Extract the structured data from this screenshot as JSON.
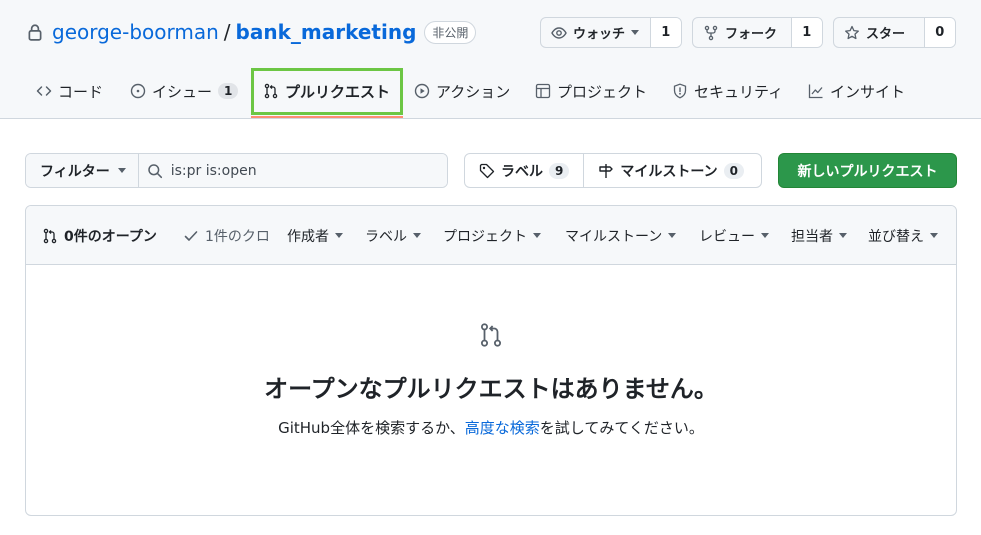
{
  "repo": {
    "owner": "george-boorman",
    "separator": "/",
    "name": "bank_marketing",
    "visibility": "非公開"
  },
  "actions": {
    "watch": {
      "label": "ウォッチ",
      "count": "1"
    },
    "fork": {
      "label": "フォーク",
      "count": "1"
    },
    "star": {
      "label": "スター",
      "count": "0"
    }
  },
  "nav": {
    "code": "コード",
    "issues": "イシュー",
    "issues_count": "1",
    "pulls": "プルリクエスト",
    "actions": "アクション",
    "projects": "プロジェクト",
    "security": "セキュリティ",
    "insights": "インサイト"
  },
  "filters": {
    "filter_label": "フィルター",
    "search_value": "is:pr is:open",
    "labels_label": "ラベル",
    "labels_count": "9",
    "milestones_label": "マイルストーン",
    "milestones_count": "0",
    "new_pr": "新しいプルリクエスト"
  },
  "list_header": {
    "open": "0件のオープン",
    "closed": "1件のクロ",
    "author": "作成者",
    "label": "ラベル",
    "projects": "プロジェクト",
    "milestones": "マイルストーン",
    "reviews": "レビュー",
    "assignee": "担当者",
    "sort": "並び替え"
  },
  "blank_state": {
    "title": "オープンなプルリクエストはありません。",
    "text_before": "GitHub全体を検索するか、",
    "link": "高度な検索",
    "text_after": "を試してみてください。"
  },
  "colors": {
    "accent": "#0969da",
    "primary_button": "#2c974b",
    "highlight": "#6cc644",
    "tab_underline": "#fd8c73"
  }
}
